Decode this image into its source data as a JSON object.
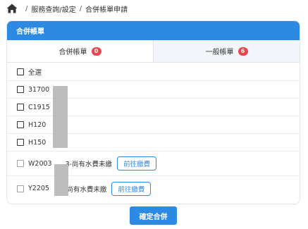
{
  "breadcrumb": {
    "home_icon": "home-icon",
    "items": [
      "服務查詢/設定",
      "合併帳單申請"
    ],
    "separator": "/"
  },
  "card": {
    "title": "合併帳單"
  },
  "tabs": [
    {
      "label": "合併帳單",
      "count": "0",
      "active": true
    },
    {
      "label": "一般帳單",
      "count": "6",
      "active": false
    }
  ],
  "select_all_label": "全選",
  "accounts": [
    {
      "label": "31700",
      "checkbox": true
    },
    {
      "label": "C1915",
      "checkbox": true
    },
    {
      "label": "H120",
      "checkbox": true
    },
    {
      "label": "H150",
      "checkbox": true
    }
  ],
  "unpaid_accounts": [
    {
      "label_prefix": "W2003",
      "label_suffix": "3-尚有水費未繳",
      "button_label": "前往繳費"
    },
    {
      "label_prefix": "Y2205",
      "label_suffix": "-尚有水費未繳",
      "button_label": "前往繳費"
    }
  ],
  "confirm_label": "確定合併",
  "colors": {
    "primary": "#2d8ae3",
    "badge": "#e5484d",
    "mask": "#bdbdbd"
  }
}
